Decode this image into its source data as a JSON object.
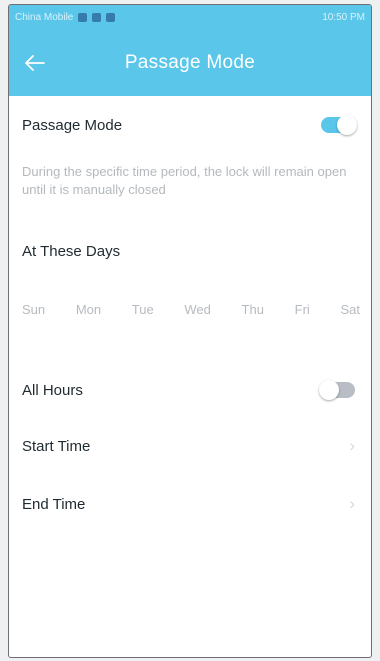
{
  "status_bar": {
    "left_text": "China Mobile",
    "right_text": "10:50 PM"
  },
  "app_bar": {
    "title": "Passage Mode",
    "back_icon": "arrow-left-icon"
  },
  "passage_mode": {
    "label": "Passage Mode",
    "enabled": true,
    "description": "During the specific time period, the lock will remain open until it is manually closed"
  },
  "days_section": {
    "heading": "At These Days",
    "days": [
      "Sun",
      "Mon",
      "Tue",
      "Wed",
      "Thu",
      "Fri",
      "Sat"
    ]
  },
  "all_hours": {
    "label": "All Hours",
    "enabled": false
  },
  "start_time": {
    "label": "Start Time"
  },
  "end_time": {
    "label": "End Time"
  },
  "colors": {
    "accent": "#59c6ea",
    "toggle_off": "#b8bdc6",
    "text": "#1f2a30",
    "muted": "#b4b9bd"
  }
}
